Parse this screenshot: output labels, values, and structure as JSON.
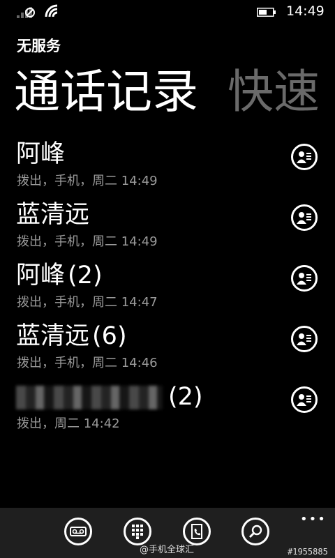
{
  "status": {
    "time": "14:49"
  },
  "header": {
    "carrier": "无服务",
    "pivot_active": "通话记录",
    "pivot_next": "快速"
  },
  "calls": [
    {
      "name": "阿峰",
      "count": "",
      "detail": "拨出，手机，周二 14:49"
    },
    {
      "name": "蓝清远",
      "count": "",
      "detail": "拨出，手机，周二 14:49"
    },
    {
      "name": "阿峰",
      "count": "(2)",
      "detail": "拨出，手机，周二 14:47"
    },
    {
      "name": "蓝清远",
      "count": "(6)",
      "detail": "拨出，手机，周二 14:46"
    },
    {
      "name": "",
      "count": "(2)",
      "detail": "拨出，周二 14:42"
    }
  ],
  "appbar": {
    "buttons": [
      "voicemail-icon",
      "keypad-icon",
      "contacts-icon",
      "search-icon"
    ],
    "more": "•••",
    "watermark": "@手机全球汇",
    "watermark_id": "#1955885"
  },
  "colors": {
    "background": "#000000",
    "appbar": "#1f1f1f",
    "secondary_text": "#9a9a9a",
    "inactive_pivot": "#6a6a6a"
  }
}
